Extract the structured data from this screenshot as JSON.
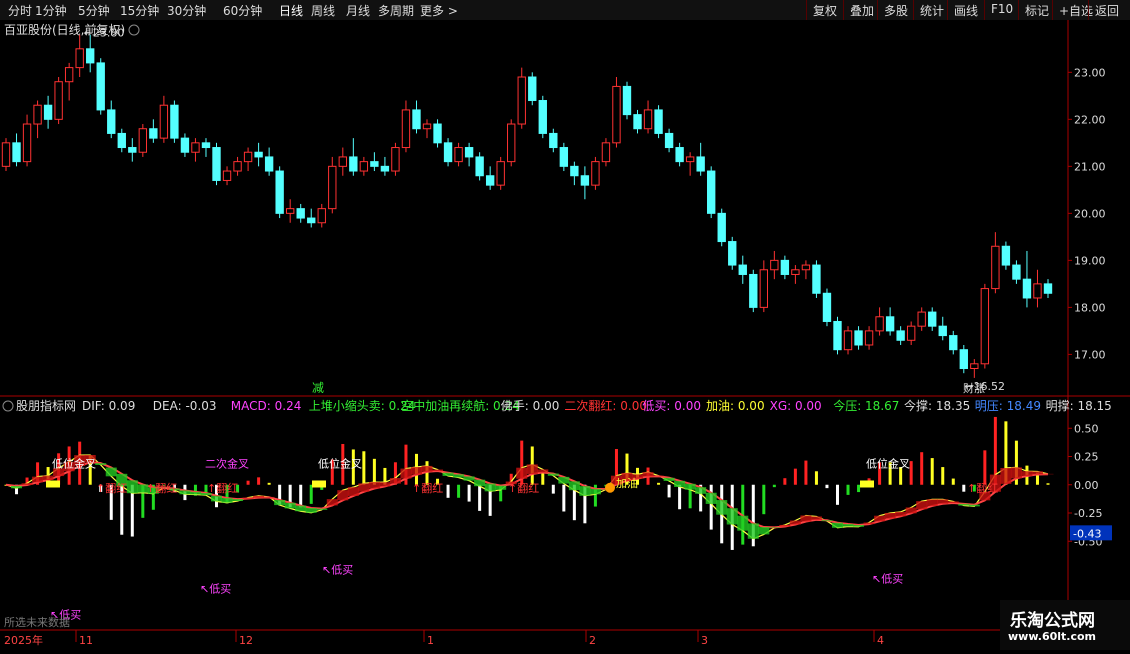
{
  "toolbar": {
    "periods": [
      "分时",
      "1分钟",
      "5分钟",
      "15分钟",
      "30分钟",
      "60分钟",
      "日线",
      "周线",
      "月线",
      "多周期",
      "更多 >"
    ],
    "active_period": "日线",
    "right_buttons": [
      "复权",
      "叠加",
      "多股",
      "统计",
      "画线",
      "F10",
      "标记",
      "+自选",
      "返回"
    ]
  },
  "main_chart": {
    "title": "百亚股份(日线,前复权)",
    "high_label": "23.80",
    "low_label": "16.52",
    "price_ticks": [
      "23.00",
      "22.00",
      "21.00",
      "20.00",
      "19.00",
      "18.00",
      "17.00"
    ],
    "price_range": [
      16.2,
      23.9
    ],
    "annotations": {
      "jian": "减",
      "caizhang": "财涨"
    }
  },
  "indicator": {
    "name": "股朋指标网",
    "values": [
      {
        "label": "DIF: 0.09",
        "color": "#dddddd"
      },
      {
        "label": "DEA: -0.03",
        "color": "#dddddd"
      },
      {
        "label": "MACD: 0.24",
        "color": "#ff44ff"
      },
      {
        "label": "上堆小缩头卖: 0.24",
        "color": "#33ee33"
      },
      {
        "label": "空中加油再续航: 0.24",
        "color": "#33ee33"
      },
      {
        "label": "佛手: 0.00",
        "color": "#dddddd"
      },
      {
        "label": "二次翻红: 0.00",
        "color": "#ff3333"
      },
      {
        "label": "低买: 0.00",
        "color": "#ff44ff"
      },
      {
        "label": "加油: 0.00",
        "color": "#ffff33"
      },
      {
        "label": "XG: 0.00",
        "color": "#ff44ff"
      },
      {
        "label": "今压: 18.67",
        "color": "#33ee33"
      },
      {
        "label": "今撑: 18.35",
        "color": "#dddddd"
      },
      {
        "label": "明压: 18.49",
        "color": "#4488ff"
      },
      {
        "label": "明撑: 18.15",
        "color": "#dddddd"
      }
    ],
    "ticks": [
      "0.50",
      "0.25",
      "0.00",
      "-0.25",
      "-0.50"
    ],
    "range": [
      -1.25,
      0.75
    ],
    "current_value": "-0.43",
    "signals": {
      "low_golden_cross": "低位金叉",
      "second_cross": "二次金叉",
      "flip_red": "翻红",
      "low_buy": "低买",
      "refuel": "加油"
    }
  },
  "time_axis": {
    "year_label": "2025年",
    "months": [
      "11",
      "12",
      "1",
      "2",
      "3",
      "4"
    ],
    "no_data_text": "所选未来数据"
  },
  "watermark": {
    "line1": "乐淘公式网",
    "line2": "www.60lt.com"
  },
  "chart_data": {
    "type": "candlestick",
    "title": "百亚股份(日线,前复权)",
    "ylim": [
      16.2,
      23.9
    ],
    "candles": [
      [
        21.0,
        21.6,
        20.9,
        21.5
      ],
      [
        21.5,
        21.7,
        21.0,
        21.1
      ],
      [
        21.1,
        22.1,
        21.0,
        21.9
      ],
      [
        21.9,
        22.4,
        21.6,
        22.3
      ],
      [
        22.3,
        22.5,
        21.8,
        22.0
      ],
      [
        22.0,
        22.9,
        21.9,
        22.8
      ],
      [
        22.8,
        23.2,
        22.4,
        23.1
      ],
      [
        23.1,
        23.8,
        22.9,
        23.5
      ],
      [
        23.5,
        23.8,
        23.0,
        23.2
      ],
      [
        23.2,
        23.3,
        22.1,
        22.2
      ],
      [
        22.2,
        22.4,
        21.6,
        21.7
      ],
      [
        21.7,
        21.8,
        21.3,
        21.4
      ],
      [
        21.4,
        21.6,
        21.1,
        21.3
      ],
      [
        21.3,
        21.9,
        21.2,
        21.8
      ],
      [
        21.8,
        22.0,
        21.5,
        21.6
      ],
      [
        21.6,
        22.5,
        21.5,
        22.3
      ],
      [
        22.3,
        22.4,
        21.5,
        21.6
      ],
      [
        21.6,
        21.7,
        21.2,
        21.3
      ],
      [
        21.3,
        21.6,
        21.1,
        21.5
      ],
      [
        21.5,
        21.6,
        21.2,
        21.4
      ],
      [
        21.4,
        21.5,
        20.6,
        20.7
      ],
      [
        20.7,
        21.0,
        20.6,
        20.9
      ],
      [
        20.9,
        21.2,
        20.8,
        21.1
      ],
      [
        21.1,
        21.4,
        20.9,
        21.3
      ],
      [
        21.3,
        21.5,
        21.0,
        21.2
      ],
      [
        21.2,
        21.4,
        20.8,
        20.9
      ],
      [
        20.9,
        21.0,
        19.9,
        20.0
      ],
      [
        20.0,
        20.3,
        19.8,
        20.1
      ],
      [
        20.1,
        20.2,
        19.8,
        19.9
      ],
      [
        19.9,
        20.1,
        19.7,
        19.8
      ],
      [
        19.8,
        20.2,
        19.7,
        20.1
      ],
      [
        20.1,
        21.2,
        20.0,
        21.0
      ],
      [
        21.0,
        21.4,
        20.8,
        21.2
      ],
      [
        21.2,
        21.6,
        20.8,
        20.9
      ],
      [
        20.9,
        21.2,
        20.8,
        21.1
      ],
      [
        21.1,
        21.3,
        20.9,
        21.0
      ],
      [
        21.0,
        21.2,
        20.8,
        20.9
      ],
      [
        20.9,
        21.5,
        20.8,
        21.4
      ],
      [
        21.4,
        22.4,
        21.3,
        22.2
      ],
      [
        22.2,
        22.4,
        21.7,
        21.8
      ],
      [
        21.8,
        22.0,
        21.6,
        21.9
      ],
      [
        21.9,
        22.0,
        21.4,
        21.5
      ],
      [
        21.5,
        21.6,
        21.0,
        21.1
      ],
      [
        21.1,
        21.5,
        21.0,
        21.4
      ],
      [
        21.4,
        21.5,
        21.0,
        21.2
      ],
      [
        21.2,
        21.3,
        20.7,
        20.8
      ],
      [
        20.8,
        21.0,
        20.5,
        20.6
      ],
      [
        20.6,
        21.2,
        20.5,
        21.1
      ],
      [
        21.1,
        22.0,
        21.0,
        21.9
      ],
      [
        21.9,
        23.1,
        21.8,
        22.9
      ],
      [
        22.9,
        23.0,
        22.3,
        22.4
      ],
      [
        22.4,
        22.5,
        21.6,
        21.7
      ],
      [
        21.7,
        21.8,
        21.3,
        21.4
      ],
      [
        21.4,
        21.5,
        20.9,
        21.0
      ],
      [
        21.0,
        21.1,
        20.6,
        20.8
      ],
      [
        20.8,
        21.0,
        20.3,
        20.6
      ],
      [
        20.6,
        21.2,
        20.5,
        21.1
      ],
      [
        21.1,
        21.6,
        21.0,
        21.5
      ],
      [
        21.5,
        22.9,
        21.4,
        22.7
      ],
      [
        22.7,
        22.8,
        22.0,
        22.1
      ],
      [
        22.1,
        22.2,
        21.7,
        21.8
      ],
      [
        21.8,
        22.4,
        21.7,
        22.2
      ],
      [
        22.2,
        22.3,
        21.6,
        21.7
      ],
      [
        21.7,
        21.8,
        21.3,
        21.4
      ],
      [
        21.4,
        21.5,
        21.0,
        21.1
      ],
      [
        21.1,
        21.3,
        20.8,
        21.2
      ],
      [
        21.2,
        21.5,
        20.8,
        20.9
      ],
      [
        20.9,
        21.0,
        19.9,
        20.0
      ],
      [
        20.0,
        20.1,
        19.3,
        19.4
      ],
      [
        19.4,
        19.5,
        18.8,
        18.9
      ],
      [
        18.9,
        19.1,
        18.5,
        18.7
      ],
      [
        18.7,
        18.8,
        17.9,
        18.0
      ],
      [
        18.0,
        19.0,
        17.9,
        18.8
      ],
      [
        18.8,
        19.2,
        18.6,
        19.0
      ],
      [
        19.0,
        19.1,
        18.6,
        18.7
      ],
      [
        18.7,
        18.9,
        18.5,
        18.8
      ],
      [
        18.8,
        19.0,
        18.6,
        18.9
      ],
      [
        18.9,
        19.0,
        18.2,
        18.3
      ],
      [
        18.3,
        18.4,
        17.6,
        17.7
      ],
      [
        17.7,
        17.8,
        17.0,
        17.1
      ],
      [
        17.1,
        17.6,
        17.0,
        17.5
      ],
      [
        17.5,
        17.6,
        17.1,
        17.2
      ],
      [
        17.2,
        17.6,
        17.1,
        17.5
      ],
      [
        17.5,
        18.0,
        17.4,
        17.8
      ],
      [
        17.8,
        18.0,
        17.4,
        17.5
      ],
      [
        17.5,
        17.6,
        17.2,
        17.3
      ],
      [
        17.3,
        17.7,
        17.2,
        17.6
      ],
      [
        17.6,
        18.0,
        17.5,
        17.9
      ],
      [
        17.9,
        18.0,
        17.5,
        17.6
      ],
      [
        17.6,
        17.8,
        17.3,
        17.4
      ],
      [
        17.4,
        17.5,
        17.0,
        17.1
      ],
      [
        17.1,
        17.2,
        16.6,
        16.7
      ],
      [
        16.7,
        16.9,
        16.5,
        16.8
      ],
      [
        16.8,
        18.5,
        16.7,
        18.4
      ],
      [
        18.4,
        19.6,
        18.3,
        19.3
      ],
      [
        19.3,
        19.4,
        18.8,
        18.9
      ],
      [
        18.9,
        19.0,
        18.5,
        18.6
      ],
      [
        18.6,
        19.2,
        18.0,
        18.2
      ],
      [
        18.2,
        18.8,
        18.0,
        18.5
      ],
      [
        18.5,
        18.6,
        18.2,
        18.3
      ]
    ]
  }
}
